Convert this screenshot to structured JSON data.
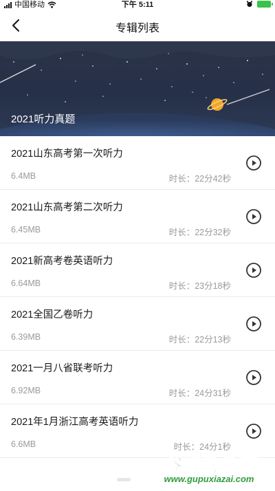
{
  "status_bar": {
    "carrier": "中国移动",
    "time": "下午 5:11",
    "battery_color": "#3bc24a"
  },
  "nav": {
    "title": "专辑列表",
    "back_icon": "chevron-left-icon"
  },
  "banner": {
    "title": "2021听力真题",
    "background": "#263048"
  },
  "list": {
    "items": [
      {
        "title": "2021山东高考第一次听力",
        "size": "6.4MB",
        "duration": "时长：22分42秒"
      },
      {
        "title": "2021山东高考第二次听力",
        "size": "6.45MB",
        "duration": "时长：22分32秒"
      },
      {
        "title": "2021新高考卷英语听力",
        "size": "6.64MB",
        "duration": "时长：23分18秒"
      },
      {
        "title": "2021全国乙卷听力",
        "size": "6.39MB",
        "duration": "时长：22分13秒"
      },
      {
        "title": "2021一月八省联考听力",
        "size": "6.92MB",
        "duration": "时长：24分31秒"
      },
      {
        "title": "2021年1月浙江高考英语听力",
        "size": "6.6MB",
        "duration": "时长：24分1秒"
      }
    ],
    "play_icon": "play-circle-icon"
  },
  "watermark": {
    "name": "谷普软件园",
    "url": "www.gupuxiazai.com"
  }
}
